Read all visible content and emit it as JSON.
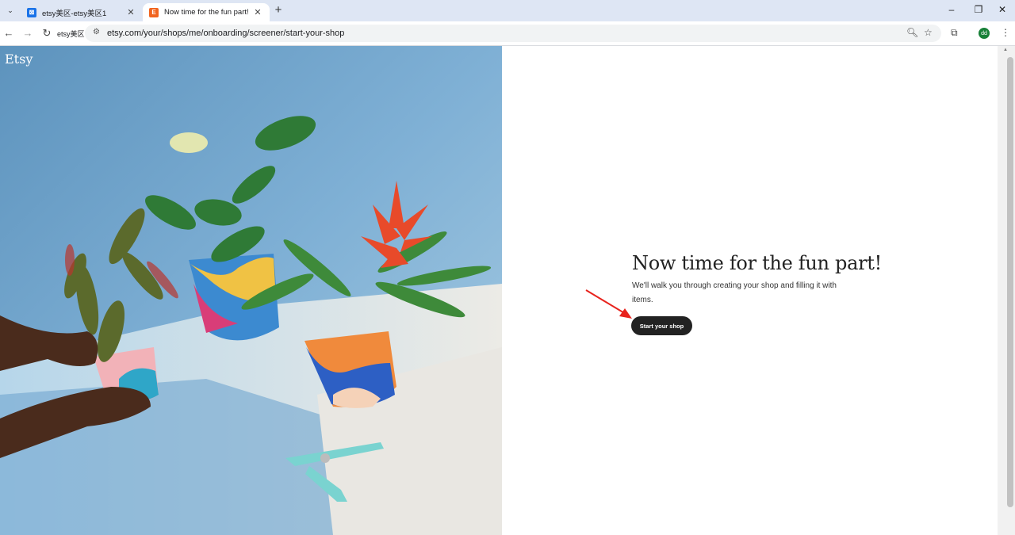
{
  "browser": {
    "tabs": [
      {
        "title": "etsy美区-etsy美区1",
        "favicon": "bookmark-doc-icon",
        "favicon_color": "#1a73e8",
        "active": false
      },
      {
        "title": "Now time for the fun part!",
        "favicon": "etsy-e-icon",
        "favicon_color": "#f1641e",
        "active": true
      }
    ],
    "bookmark_label": "etsy美区",
    "url": "etsy.com/your/shops/me/onboarding/screener/start-your-shop",
    "profile_initials": "dd",
    "profile_color": "#188038"
  },
  "page": {
    "logo": "Etsy",
    "headline": "Now time for the fun part!",
    "subtext": "We'll walk you through creating your shop and filling it with items.",
    "cta_label": "Start your shop",
    "cta_color": "#222222",
    "annotation_color": "#e8231d"
  }
}
